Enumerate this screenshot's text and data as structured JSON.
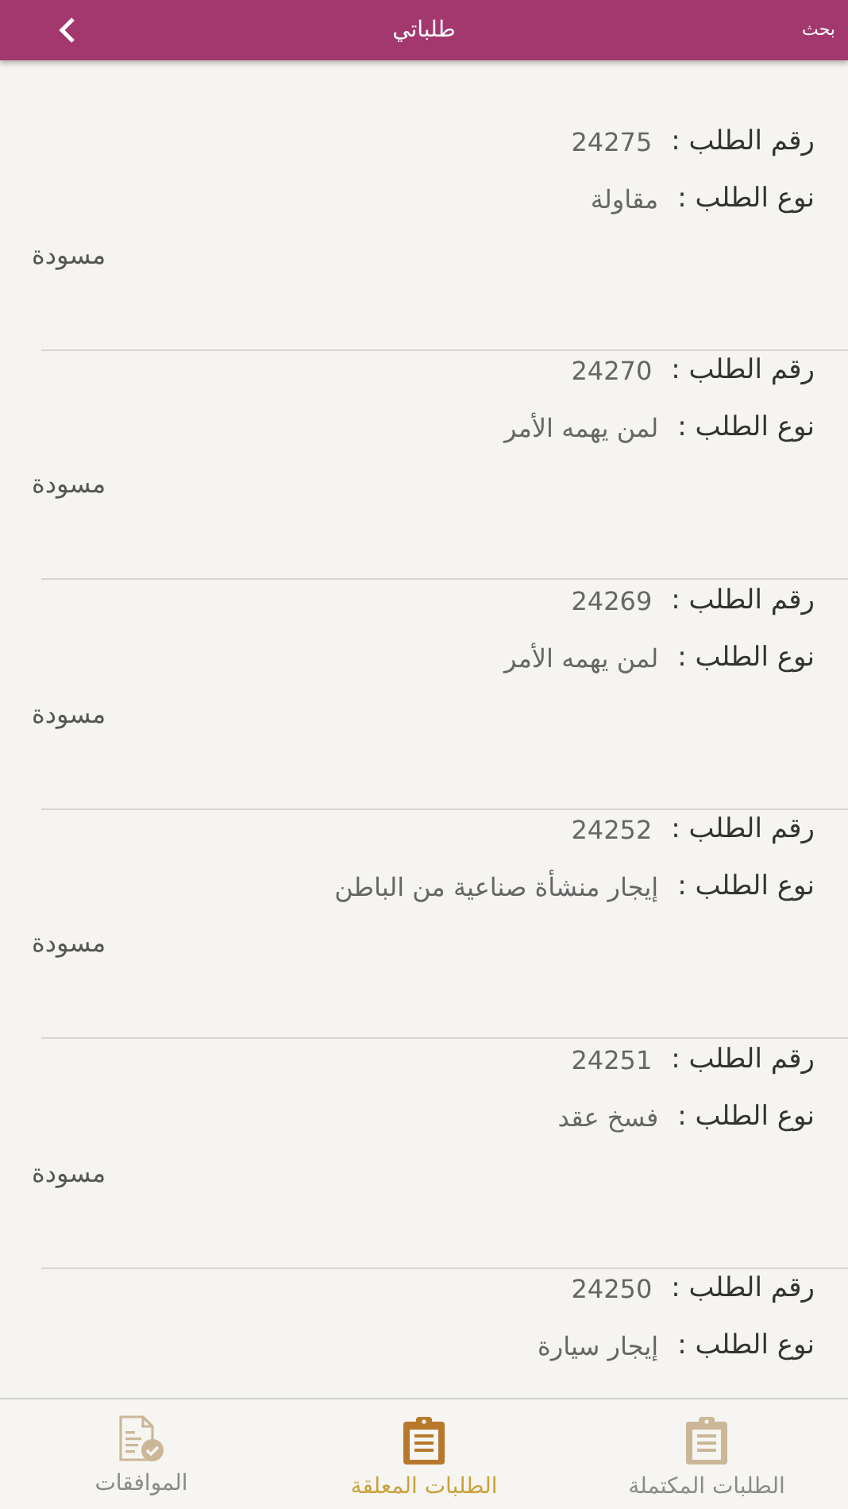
{
  "header": {
    "search": "بحث",
    "title": "طلباتي"
  },
  "requests": [
    {
      "number_label": "رقم الطلب :",
      "number": "24275",
      "type_label": "نوع الطلب :",
      "type": "مقاولة",
      "status": "مسودة"
    },
    {
      "number_label": "رقم الطلب :",
      "number": "24270",
      "type_label": "نوع الطلب :",
      "type": "لمن يهمه الأمر",
      "status": "مسودة"
    },
    {
      "number_label": "رقم الطلب :",
      "number": "24269",
      "type_label": "نوع الطلب :",
      "type": "لمن يهمه الأمر",
      "status": "مسودة"
    },
    {
      "number_label": "رقم الطلب :",
      "number": "24252",
      "type_label": "نوع الطلب :",
      "type": "إيجار منشأة صناعية من الباطن",
      "status": "مسودة"
    },
    {
      "number_label": "رقم الطلب :",
      "number": "24251",
      "type_label": "نوع الطلب :",
      "type": "فسخ عقد",
      "status": "مسودة"
    },
    {
      "number_label": "رقم الطلب :",
      "number": "24250",
      "type_label": "نوع الطلب :",
      "type": "إيجار سيارة"
    }
  ],
  "tabs": [
    {
      "label": "الطلبات المكتملة",
      "kind": "clipboard",
      "selected": false
    },
    {
      "label": "الطلبات المعلقة",
      "kind": "clipboard",
      "selected": true
    },
    {
      "label": "الموافقات",
      "kind": "approval",
      "selected": false
    }
  ]
}
